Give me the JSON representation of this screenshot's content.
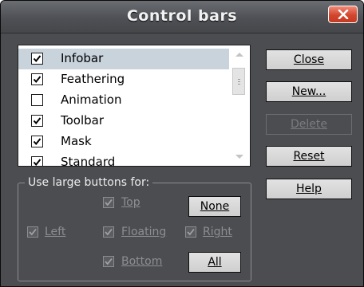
{
  "window": {
    "title": "Control bars"
  },
  "list": {
    "items": [
      {
        "label": "Infobar",
        "checked": true,
        "selected": true
      },
      {
        "label": "Feathering",
        "checked": true,
        "selected": false
      },
      {
        "label": "Animation",
        "checked": false,
        "selected": false
      },
      {
        "label": "Toolbar",
        "checked": true,
        "selected": false
      },
      {
        "label": "Mask",
        "checked": true,
        "selected": false
      },
      {
        "label": "Standard",
        "checked": true,
        "selected": false
      }
    ]
  },
  "buttons": {
    "close": "Close",
    "new": "New...",
    "delete": "Delete",
    "reset": "Reset",
    "help": "Help"
  },
  "large_buttons": {
    "label": "Use large buttons for:",
    "top": "Top",
    "left": "Left",
    "floating": "Floating",
    "right": "Right",
    "bottom": "Bottom",
    "none": "None",
    "all": "All"
  },
  "colors": {
    "window_bg": "#4b4d51",
    "selection": "#c8d3dc",
    "close_button": "#d3462e"
  }
}
